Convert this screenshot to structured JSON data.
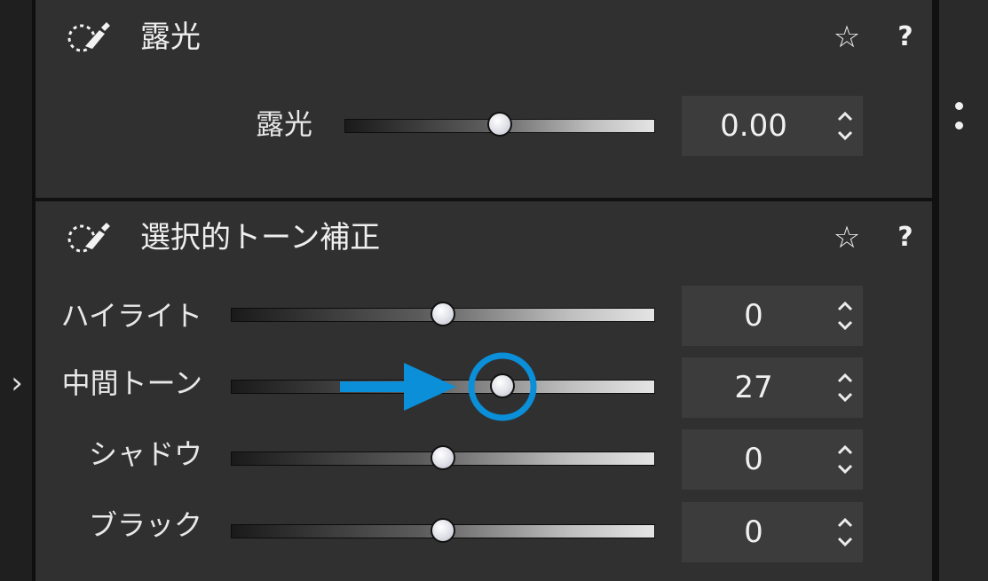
{
  "exposure_section": {
    "title": "露光",
    "sliders": [
      {
        "label": "露光",
        "value": "0.00",
        "position": 0.5
      }
    ]
  },
  "tone_section": {
    "title": "選択的トーン補正",
    "sliders": [
      {
        "label": "ハイライト",
        "value": "0",
        "position": 0.5
      },
      {
        "label": "中間トーン",
        "value": "27",
        "position": 0.64
      },
      {
        "label": "シャドウ",
        "value": "0",
        "position": 0.5
      },
      {
        "label": "ブラック",
        "value": "0",
        "position": 0.5
      }
    ]
  },
  "icons": {
    "section_icon": "brush-selection-icon",
    "favorite": "star-icon",
    "help": "help-icon",
    "expand": "chevron-right-icon",
    "menu": "more-vertical-icon",
    "spinner": "up-down-spinner-icon"
  },
  "glyphs": {
    "star": "☆",
    "help": "?",
    "expand": "›"
  },
  "colors": {
    "panel_bg": "#303030",
    "value_box_bg": "#3c3c3c",
    "annotation": "#0a8fd8"
  }
}
